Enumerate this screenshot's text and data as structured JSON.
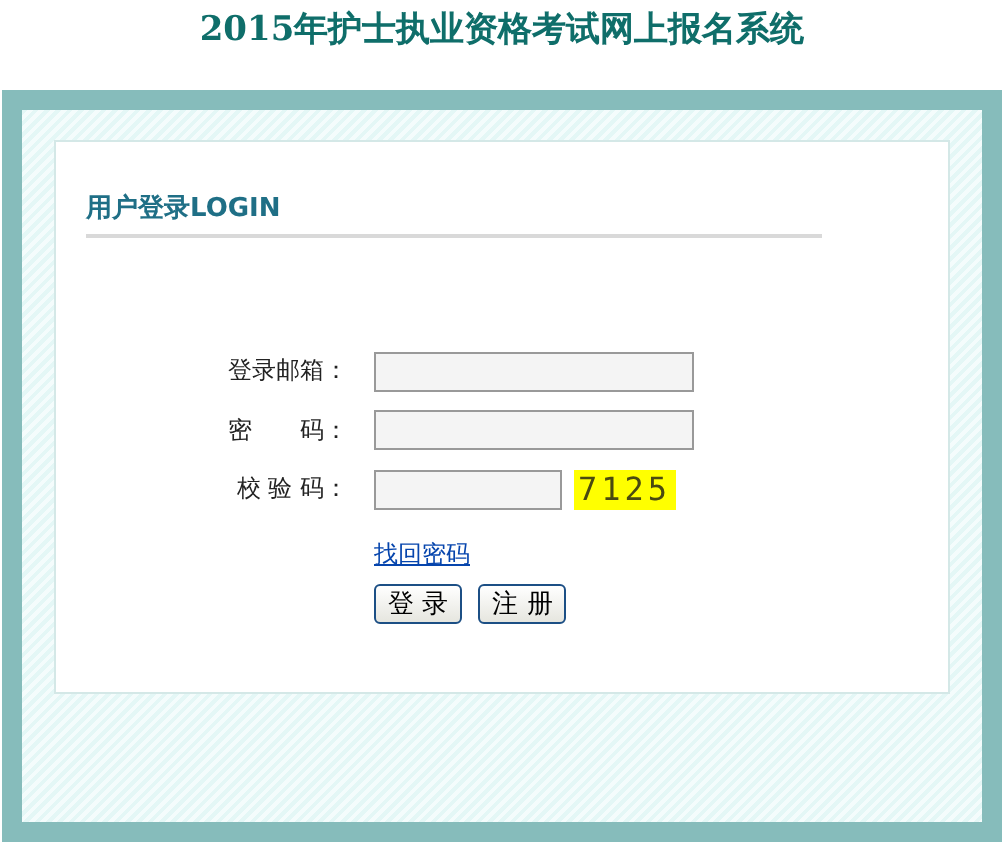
{
  "page_title": "2015年护士执业资格考试网上报名系统",
  "login": {
    "heading": "用户登录LOGIN",
    "fields": [
      {
        "kind": "text",
        "label": "登录邮箱："
      },
      {
        "kind": "text",
        "label": "密　　码："
      },
      {
        "kind": "captcha",
        "label": "校 验 码：",
        "captcha": "7125"
      }
    ],
    "link": "找回密码",
    "buttons": [
      "登 录",
      "注 册"
    ]
  }
}
